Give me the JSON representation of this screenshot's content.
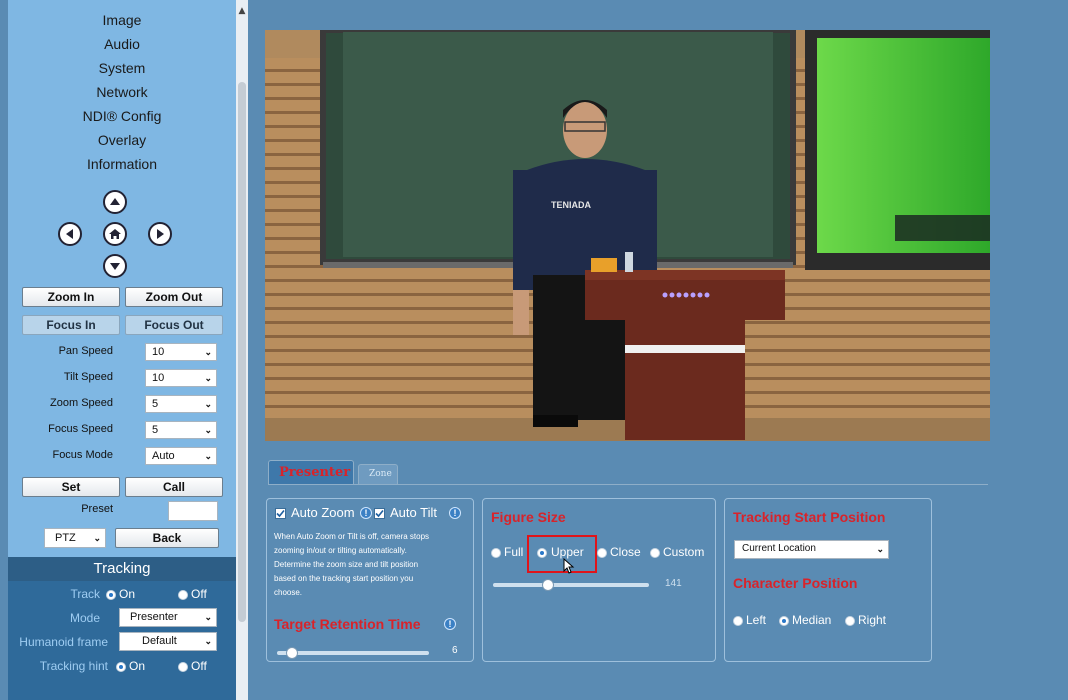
{
  "menu": [
    "Image",
    "Audio",
    "System",
    "Network",
    "NDI® Config",
    "Overlay",
    "Information"
  ],
  "ptz_buttons": {
    "zoom_in": "Zoom In",
    "zoom_out": "Zoom Out",
    "focus_in": "Focus In",
    "focus_out": "Focus Out",
    "set": "Set",
    "call": "Call",
    "back": "Back"
  },
  "speeds": {
    "pan": {
      "label": "Pan Speed",
      "value": "10"
    },
    "tilt": {
      "label": "Tilt Speed",
      "value": "10"
    },
    "zoom": {
      "label": "Zoom Speed",
      "value": "5"
    },
    "focus": {
      "label": "Focus Speed",
      "value": "5"
    },
    "focus_mode": {
      "label": "Focus Mode",
      "value": "Auto"
    }
  },
  "preset": {
    "label": "Preset",
    "value": ""
  },
  "ptz_select": "PTZ",
  "tracking": {
    "title": "Tracking",
    "track": {
      "label": "Track",
      "on": "On",
      "off": "Off",
      "selected": "On"
    },
    "mode": {
      "label": "Mode",
      "value": "Presenter"
    },
    "humanoid": {
      "label": "Humanoid frame",
      "value": "Default"
    },
    "hint": {
      "label": "Tracking hint",
      "on": "On",
      "off": "Off",
      "selected": "On"
    }
  },
  "tabs": [
    {
      "label": "Presenter",
      "active": true
    },
    {
      "label": "Zone",
      "active": false
    }
  ],
  "auto_panel": {
    "auto_zoom": "Auto Zoom",
    "auto_tilt": "Auto Tilt",
    "help_lines": [
      "When Auto Zoom or Tilt is off, camera stops",
      "zooming in/out or tilting automatically.",
      "Determine the zoom size and tilt position",
      "based on the tracking start position you",
      "choose."
    ],
    "retention_title": "Target Retention Time",
    "retention_value": "6",
    "retention_fraction": 0.1
  },
  "figure_panel": {
    "title": "Figure Size",
    "options": [
      "Full",
      "Upper",
      "Close",
      "Custom"
    ],
    "selected": "Upper",
    "slider_value": "141",
    "slider_fraction": 0.35
  },
  "start_panel": {
    "title": "Tracking Start Position",
    "select_value": "Current Location",
    "character_title": "Character Position",
    "options": [
      "Left",
      "Median",
      "Right"
    ],
    "selected": "Median"
  },
  "scene": {
    "shirt_text": "TENIADA"
  },
  "colors": {
    "accent_red": "#d8232a",
    "sidebar": "#7fb7e3",
    "background": "#5a8bb3",
    "tracking_header": "#2d5e86"
  }
}
